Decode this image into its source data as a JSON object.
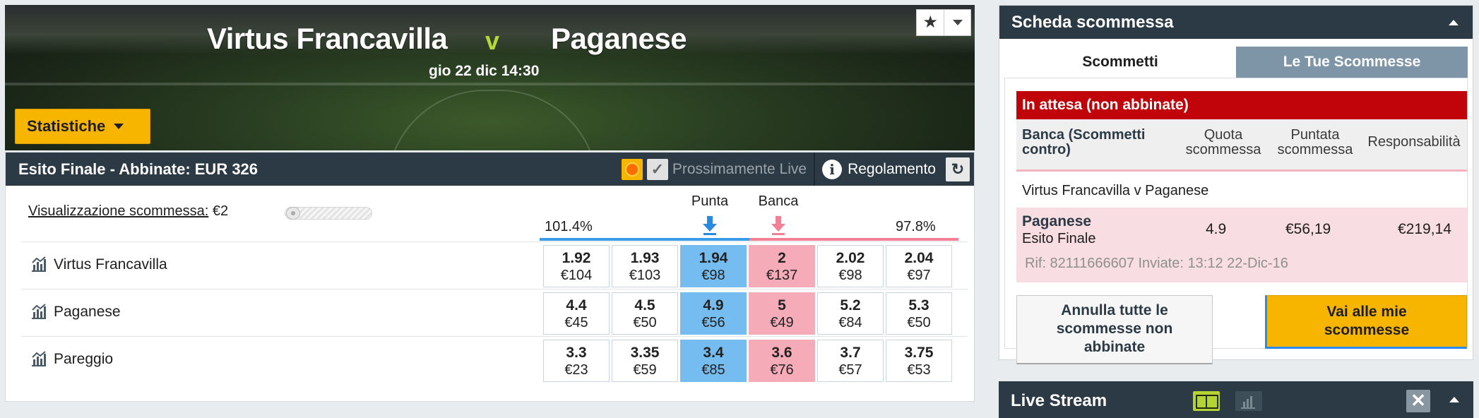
{
  "event": {
    "home": "Virtus Francavilla",
    "separator": "v",
    "away": "Paganese",
    "datetime": "gio 22 dic 14:30",
    "stats_button": "Statistiche",
    "favorite_icon": "star-icon"
  },
  "market": {
    "title": "Esito Finale - Abbinate: EUR 326",
    "soon_live_label": "Prossimamente Live",
    "rules_label": "Regolamento",
    "view_label": "Visualizzazione scommessa:",
    "view_value": "€2",
    "back_header": "Punta",
    "lay_header": "Banca",
    "back_overround": "101.4%",
    "lay_overround": "97.8%",
    "colors": {
      "back": "#75bdf0",
      "lay": "#f6abb9",
      "header": "#2b3a45",
      "accent": "#f7b500"
    },
    "runners": [
      {
        "name": "Virtus Francavilla",
        "prices": [
          {
            "odds": "1.92",
            "size": "€104"
          },
          {
            "odds": "1.93",
            "size": "€103"
          },
          {
            "odds": "1.94",
            "size": "€98"
          },
          {
            "odds": "2",
            "size": "€137"
          },
          {
            "odds": "2.02",
            "size": "€98"
          },
          {
            "odds": "2.04",
            "size": "€97"
          }
        ]
      },
      {
        "name": "Paganese",
        "prices": [
          {
            "odds": "4.4",
            "size": "€45"
          },
          {
            "odds": "4.5",
            "size": "€50"
          },
          {
            "odds": "4.9",
            "size": "€56"
          },
          {
            "odds": "5",
            "size": "€49"
          },
          {
            "odds": "5.2",
            "size": "€84"
          },
          {
            "odds": "5.3",
            "size": "€50"
          }
        ]
      },
      {
        "name": "Pareggio",
        "prices": [
          {
            "odds": "3.3",
            "size": "€23"
          },
          {
            "odds": "3.35",
            "size": "€59"
          },
          {
            "odds": "3.4",
            "size": "€85"
          },
          {
            "odds": "3.6",
            "size": "€76"
          },
          {
            "odds": "3.7",
            "size": "€57"
          },
          {
            "odds": "3.75",
            "size": "€53"
          }
        ]
      }
    ]
  },
  "betslip": {
    "title": "Scheda scommessa",
    "tabs": [
      "Scommetti",
      "Le Tue Scommesse"
    ],
    "pending_title": "In attesa (non abbinate)",
    "col_bet_type_1": "Banca (Scommetti",
    "col_bet_type_2": "contro)",
    "col_odds_1": "Quota",
    "col_odds_2": "scommessa",
    "col_stake_1": "Puntata",
    "col_stake_2": "scommessa",
    "col_liability": "Responsabilità",
    "match": "Virtus Francavilla v Paganese",
    "bet": {
      "selection": "Paganese",
      "market": "Esito Finale",
      "odds": "4.9",
      "stake": "€56,19",
      "liability": "€219,14",
      "reference": "Rif: 82111666607 Inviate: 13:12 22-Dic-16"
    },
    "cancel_button": [
      "Annulla tutte le",
      "scommesse non",
      "abbinate"
    ],
    "go_button": [
      "Vai alle mie",
      "scommesse"
    ]
  },
  "live_stream": {
    "title": "Live Stream"
  }
}
